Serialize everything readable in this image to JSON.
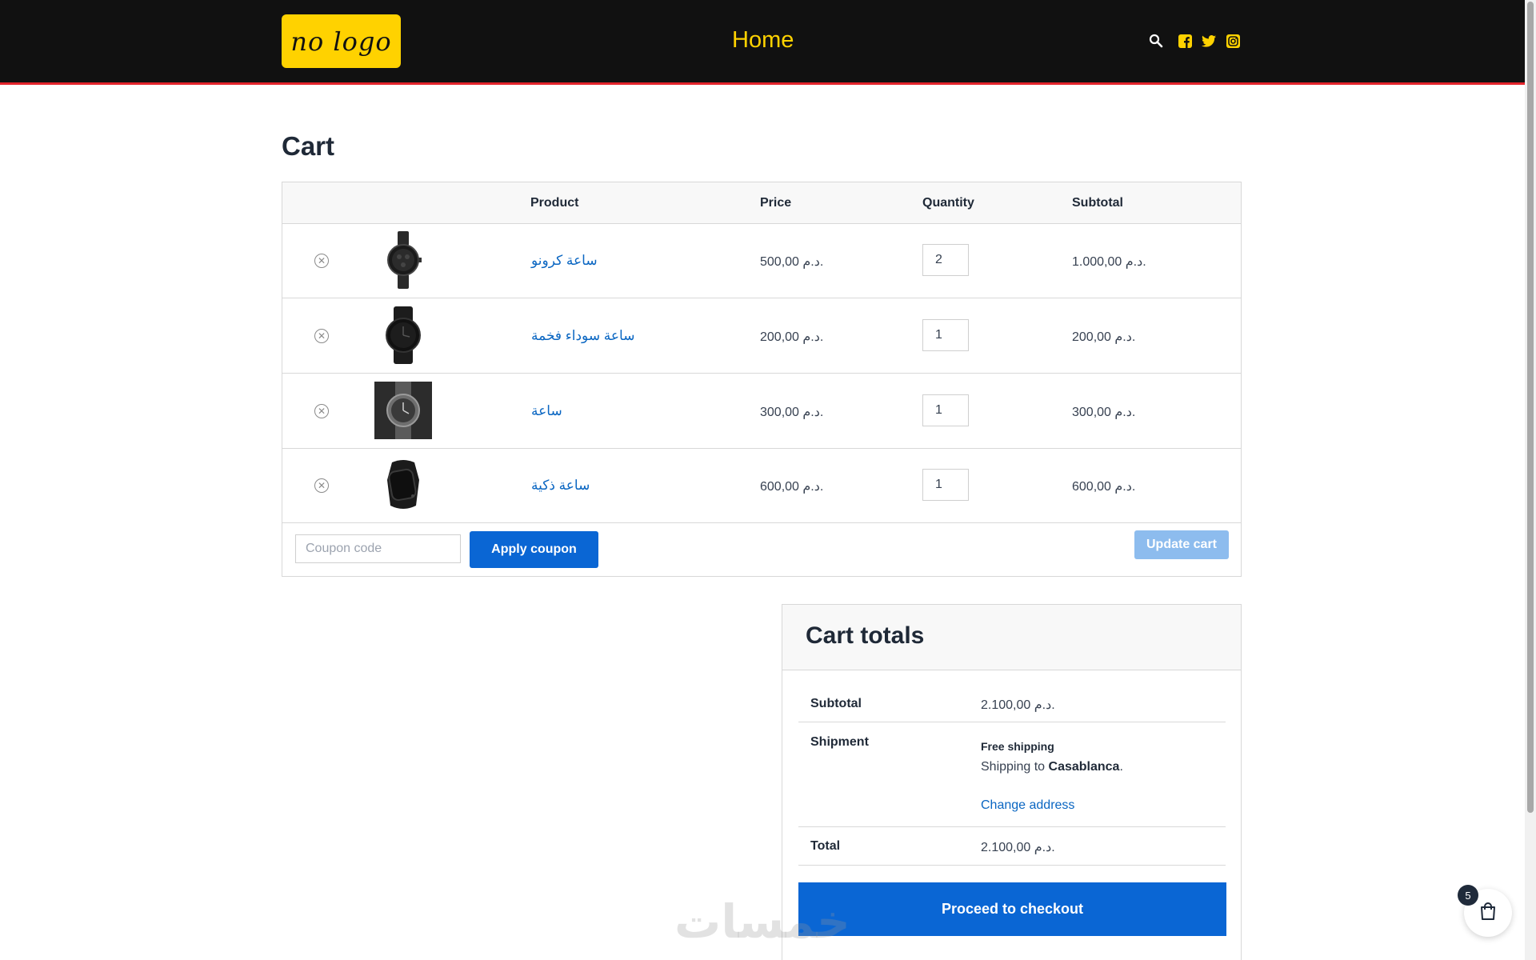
{
  "header": {
    "logo_text": "no logo",
    "nav_home": "Home",
    "icons": [
      "search-icon",
      "facebook-icon",
      "twitter-icon",
      "instagram-icon"
    ],
    "accent_color": "#ffd200",
    "bar_color": "#111111",
    "border_color": "#e3242b"
  },
  "page": {
    "title": "Cart"
  },
  "cart": {
    "columns": {
      "product": "Product",
      "price": "Price",
      "quantity": "Quantity",
      "subtotal": "Subtotal"
    },
    "items": [
      {
        "name": "ساعة كرونو",
        "price": "500,00 د.م.",
        "quantity": "2",
        "subtotal": "1.000,00 د.م.",
        "image": "chronograph-watch-image"
      },
      {
        "name": "ساعة سوداء فخمة",
        "price": "200,00 د.م.",
        "quantity": "1",
        "subtotal": "200,00 د.م.",
        "image": "black-watch-image"
      },
      {
        "name": "ساعة",
        "price": "300,00 د.م.",
        "quantity": "1",
        "subtotal": "300,00 د.م.",
        "image": "watch-photo-image"
      },
      {
        "name": "ساعة ذكية",
        "price": "600,00 د.م.",
        "quantity": "1",
        "subtotal": "600,00 د.م.",
        "image": "smart-watch-image"
      }
    ],
    "remove_icon": "close-circle-icon",
    "coupon_placeholder": "Coupon code",
    "apply_coupon": "Apply coupon",
    "update_cart": "Update cart"
  },
  "totals": {
    "title": "Cart totals",
    "subtotal_label": "Subtotal",
    "subtotal_value": "2.100,00 د.م.",
    "shipment_label": "Shipment",
    "shipping_method": "Free shipping",
    "shipping_to_prefix": "Shipping to ",
    "shipping_city": "Casablanca",
    "shipping_to_suffix": ".",
    "change_address": "Change address",
    "total_label": "Total",
    "total_value": "2.100,00 د.م.",
    "checkout": "Proceed to checkout"
  },
  "watermark": "خمسات",
  "floating_cart": {
    "count": "5",
    "icon": "shopping-bag-icon"
  }
}
